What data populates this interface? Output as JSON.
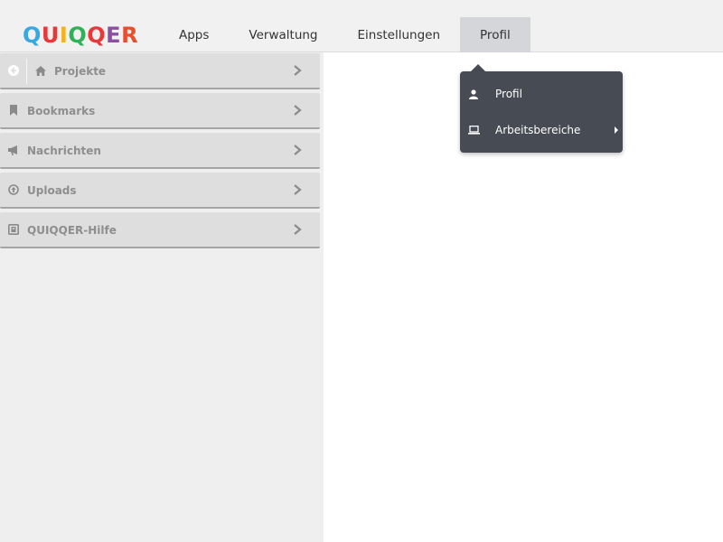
{
  "logo": {
    "letters": [
      "Q",
      "U",
      "I",
      "Q",
      "Q",
      "E",
      "R"
    ],
    "colors": [
      "#3aa8e0",
      "#e8393a",
      "#f4b31c",
      "#2fb157",
      "#e8393a",
      "#8a4fa3",
      "#e84e2c"
    ]
  },
  "nav": {
    "items": [
      "Apps",
      "Verwaltung",
      "Einstellungen",
      "Profil"
    ],
    "active": "Profil"
  },
  "sidebar": {
    "panels": [
      {
        "label": "Projekte",
        "icon": "home-icon"
      },
      {
        "label": "Bookmarks",
        "icon": "bookmark-icon"
      },
      {
        "label": "Nachrichten",
        "icon": "bullhorn-icon"
      },
      {
        "label": "Uploads",
        "icon": "upload-circle-icon"
      },
      {
        "label": "QUIQQER-Hilfe",
        "icon": "help-box-icon"
      }
    ]
  },
  "dropdown": {
    "items": [
      {
        "label": "Profil",
        "icon": "user-icon"
      },
      {
        "label": "Arbeitsbereiche",
        "icon": "laptop-icon",
        "has_submenu": true
      }
    ]
  },
  "colors": {
    "dropdown_bg": "#464b54",
    "active_tab": "#d4d6da",
    "panel_bg": "#dedede",
    "sidebar_bg": "#efefef"
  }
}
